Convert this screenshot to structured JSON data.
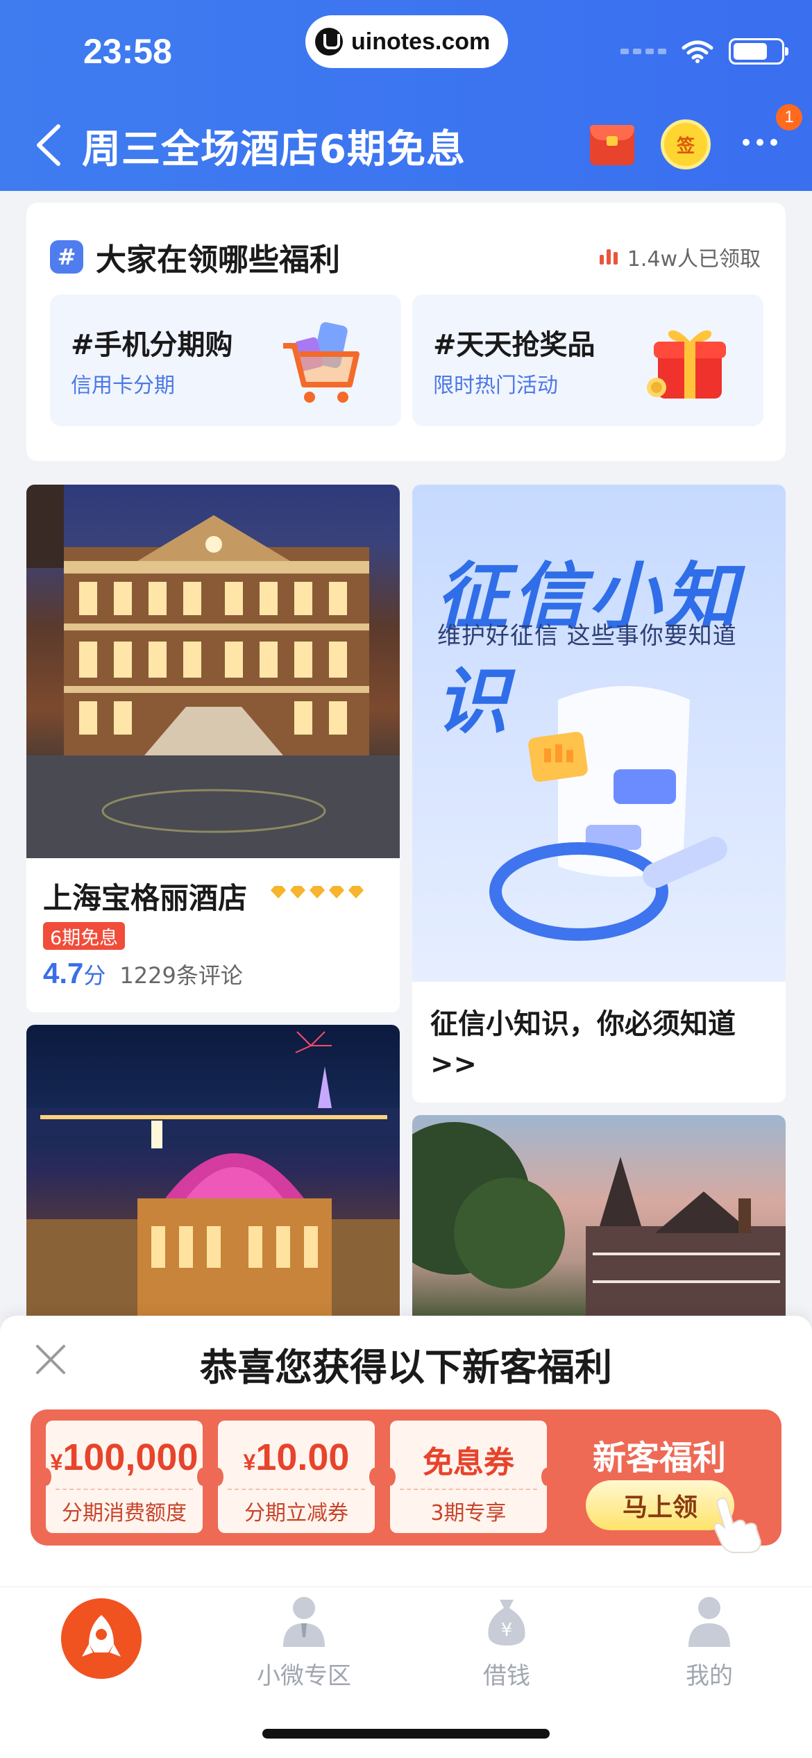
{
  "status_bar": {
    "time": "23:58",
    "site": "uinotes.com"
  },
  "nav": {
    "title": "周三全场酒店6期免息",
    "sign_label": "签",
    "badge_count": "1"
  },
  "welfare": {
    "title": "大家在领哪些福利",
    "count": "1.4w人已领取",
    "tiles": [
      {
        "title": "#手机分期购",
        "subtitle": "信用卡分期",
        "icon": "shopping-cart-icon"
      },
      {
        "title": "#天天抢奖品",
        "subtitle": "限时热门活动",
        "icon": "gift-box-icon"
      }
    ]
  },
  "feed": {
    "hotel": {
      "name": "上海宝格丽酒店",
      "star_count": 5,
      "tag": "6期免息",
      "score": "4.7",
      "score_unit": "分",
      "reviews": "1229条评论"
    },
    "credit_article": {
      "banner_title": "征信小知识",
      "banner_subtitle": "维护好征信 这些事你要知道",
      "caption": "征信小知识，你必须知道>>"
    }
  },
  "popup": {
    "title": "恭喜您获得以下新客福利",
    "coupons": [
      {
        "currency": "¥",
        "amount": "100,000",
        "label": "分期消费额度"
      },
      {
        "currency": "¥",
        "amount": "10.00",
        "label": "分期立减券"
      },
      {
        "text": "免息券",
        "label": "3期专享"
      }
    ],
    "newbie_title": "新客福利",
    "claim_label": "马上领"
  },
  "tabbar": {
    "items": [
      {
        "label": "",
        "active": true
      },
      {
        "label": "小微专区"
      },
      {
        "label": "借钱"
      },
      {
        "label": "我的"
      }
    ]
  },
  "colors": {
    "brand_blue": "#3f7cf0",
    "accent_red": "#ee6a55",
    "tab_active": "#f0531f"
  }
}
